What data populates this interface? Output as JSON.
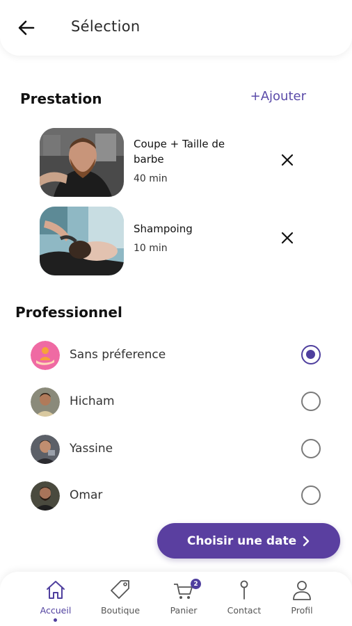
{
  "header": {
    "title": "Sélection"
  },
  "prestation": {
    "title": "Prestation",
    "add_label": "+Ajouter",
    "services": [
      {
        "name": "Coupe + Taille de barbe",
        "duration": "40 min"
      },
      {
        "name": "Shampoing",
        "duration": "10 min"
      }
    ]
  },
  "professionnel": {
    "title": "Professionnel",
    "items": [
      {
        "name": "Sans préference",
        "selected": true
      },
      {
        "name": "Hicham",
        "selected": false
      },
      {
        "name": "Yassine",
        "selected": false
      },
      {
        "name": "Omar",
        "selected": false
      }
    ]
  },
  "cta": {
    "label": "Choisir une date",
    "icon": "chevron-right-icon"
  },
  "nav": {
    "items": [
      {
        "label": "Accueil",
        "icon": "home-icon",
        "active": true
      },
      {
        "label": "Boutique",
        "icon": "tag-icon",
        "active": false
      },
      {
        "label": "Panier",
        "icon": "cart-icon",
        "active": false,
        "badge": "2"
      },
      {
        "label": "Contact",
        "icon": "map-pin-icon",
        "active": false
      },
      {
        "label": "Profil",
        "icon": "user-icon",
        "active": false
      }
    ]
  },
  "colors": {
    "accent": "#5a3fa0",
    "accent_dark": "#4f3f9e"
  }
}
